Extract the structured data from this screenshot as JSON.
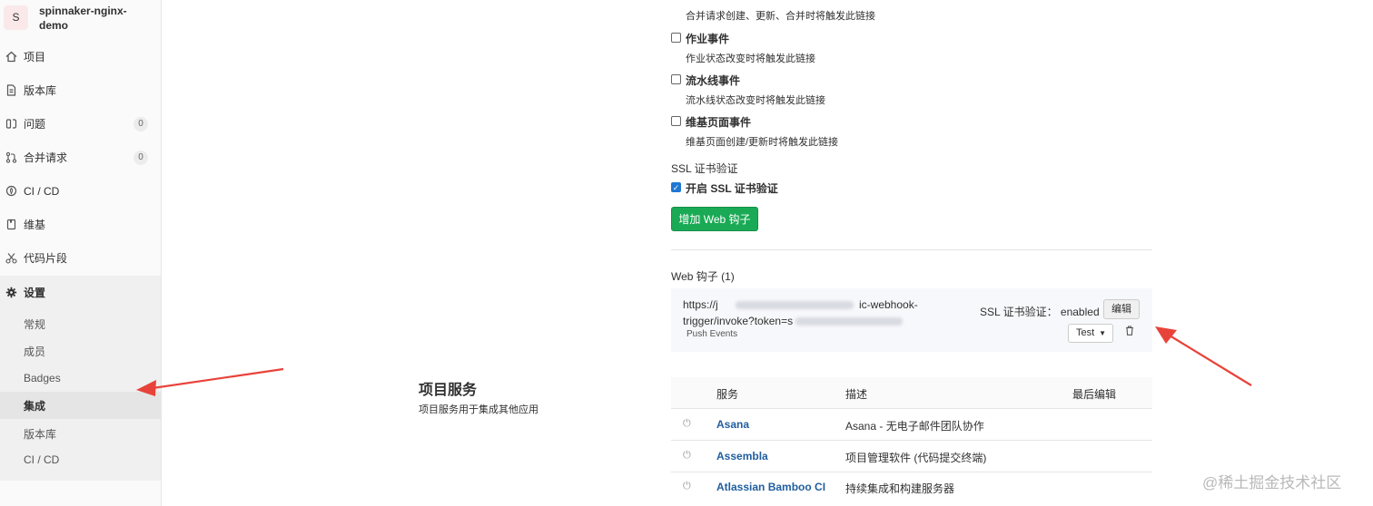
{
  "project": {
    "avatar_letter": "S",
    "name": "spinnaker-nginx-demo"
  },
  "sidebar": {
    "items": [
      {
        "label": "项目",
        "icon": "home-icon"
      },
      {
        "label": "版本库",
        "icon": "document-icon"
      },
      {
        "label": "问题",
        "icon": "issues-icon",
        "count": "0"
      },
      {
        "label": "合并请求",
        "icon": "merge-request-icon",
        "count": "0"
      },
      {
        "label": "CI / CD",
        "icon": "rocket-icon"
      },
      {
        "label": "维基",
        "icon": "book-icon"
      },
      {
        "label": "代码片段",
        "icon": "scissors-icon"
      },
      {
        "label": "设置",
        "icon": "gear-icon"
      }
    ],
    "settings_sub": [
      "常规",
      "成员",
      "Badges",
      "集成",
      "版本库",
      "CI / CD"
    ],
    "active_sub": "集成"
  },
  "events": [
    {
      "title": "",
      "desc": "合并请求创建、更新、合并时将触发此链接",
      "checked": false
    },
    {
      "title": "作业事件",
      "desc": "作业状态改变时将触发此链接",
      "checked": false
    },
    {
      "title": "流水线事件",
      "desc": "流水线状态改变时将触发此链接",
      "checked": false
    },
    {
      "title": "维基页面事件",
      "desc": "维基页面创建/更新时将触发此链接",
      "checked": false
    }
  ],
  "ssl": {
    "heading": "SSL 证书验证",
    "checkbox_label": "开启 SSL 证书验证",
    "checked": true
  },
  "add_button": "增加 Web 钩子",
  "hooks": {
    "heading": "Web 钩子 (1)",
    "item": {
      "url_line1": "https://j",
      "url_line1_end": "ic-webhook-",
      "url_line2": "trigger/invoke?token=s",
      "events": "Push Events",
      "ssl_text": "SSL 证书验证： enabled",
      "edit_label": "编辑",
      "test_label": "Test"
    }
  },
  "services": {
    "title": "项目服务",
    "description": "项目服务用于集成其他应用",
    "columns": [
      "服务",
      "描述",
      "最后编辑"
    ],
    "rows": [
      {
        "name": "Asana",
        "desc": "Asana - 无电子邮件团队协作"
      },
      {
        "name": "Assembla",
        "desc": "项目管理软件 (代码提交终端)"
      },
      {
        "name": "Atlassian Bamboo CI",
        "desc": "持续集成和构建服务器"
      }
    ]
  },
  "watermark": "@稀土掘金技术社区",
  "colors": {
    "primary_button": "#1aaa55",
    "link": "#1f5e9e",
    "arrow": "#e8433a",
    "checkbox": "#1f78d1"
  }
}
